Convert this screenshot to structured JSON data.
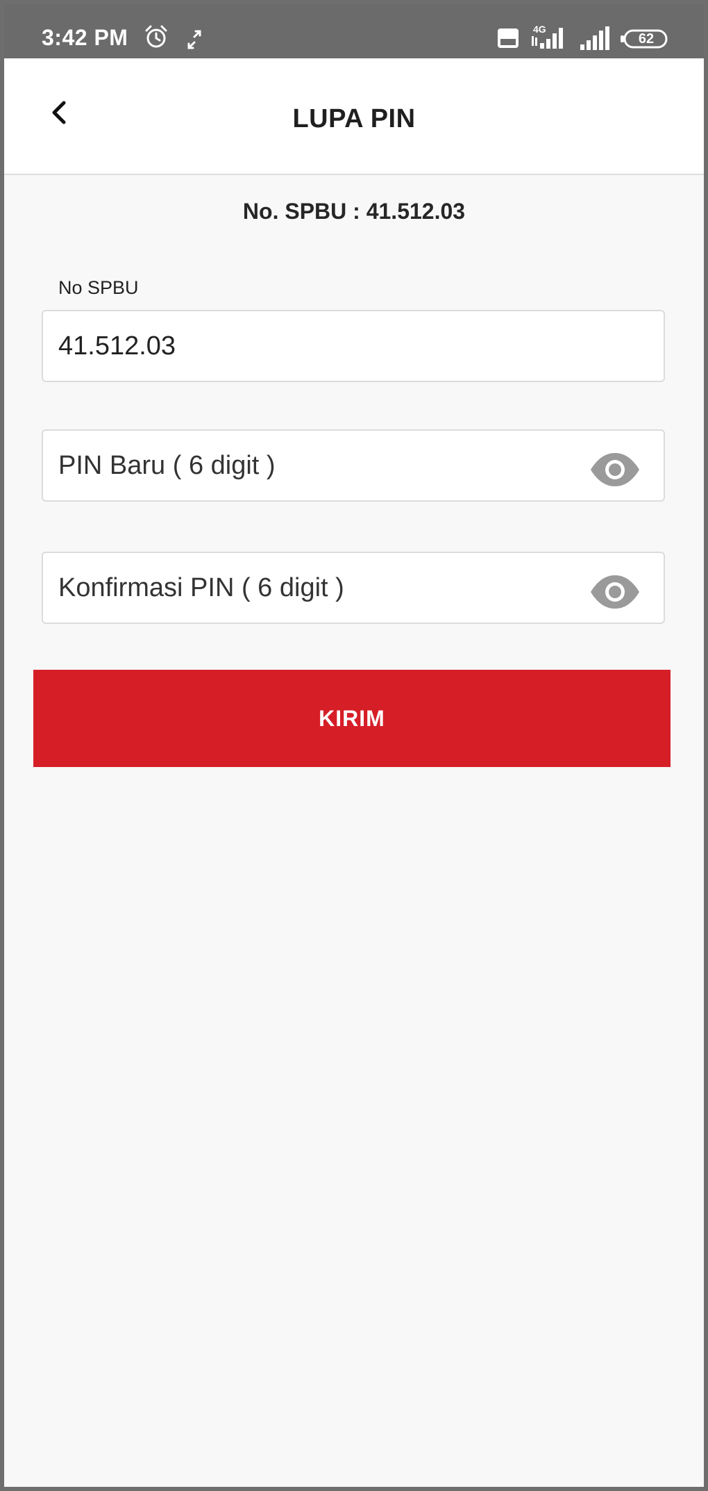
{
  "status_bar": {
    "time": "3:42 PM",
    "icons": [
      "alarm-icon",
      "sync-icon",
      "volte-icon",
      "signal-4g-icon",
      "signal-icon",
      "battery-icon"
    ],
    "battery_level": "62",
    "network_label": "4G"
  },
  "app_bar": {
    "title": "LUPA PIN",
    "back_icon": "chevron-left-icon"
  },
  "spbu_heading": "No. SPBU : 41.512.03",
  "form": {
    "spbu_label": "No SPBU",
    "spbu_value": "41.512.03",
    "new_pin_placeholder": "PIN Baru ( 6 digit )",
    "confirm_pin_placeholder": "Konfirmasi PIN ( 6 digit )",
    "toggle_icon": "eye-icon",
    "submit_label": "KIRIM"
  },
  "colors": {
    "accent": "#d61e27",
    "status_bar": "#6b6b6b",
    "background": "#f8f8f8"
  }
}
